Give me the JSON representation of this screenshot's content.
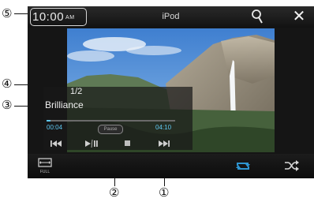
{
  "header": {
    "clock_time": "10:00",
    "clock_ampm": "AM",
    "source_title": "iPod"
  },
  "now_playing": {
    "track_count": "1/2",
    "track_title": "Brilliance",
    "elapsed_time": "00:04",
    "remaining_time": "04:10",
    "progress_fraction": 0.03,
    "pause_badge": "Pause"
  },
  "controls": {
    "prev_icon": "previous-track-icon",
    "play_pause_icon": "play-pause-icon",
    "stop_icon": "stop-icon",
    "next_icon": "next-track-icon"
  },
  "bottom_bar": {
    "full_label": "FULL",
    "repeat_icon": "repeat-icon",
    "shuffle_icon": "shuffle-icon"
  },
  "callouts": {
    "c1": "①",
    "c2": "②",
    "c3": "③",
    "c4": "④",
    "c5": "⑤"
  },
  "colors": {
    "accent": "#5fc8f2",
    "repeat": "#2e95d0",
    "screen_bg": "#151515"
  }
}
